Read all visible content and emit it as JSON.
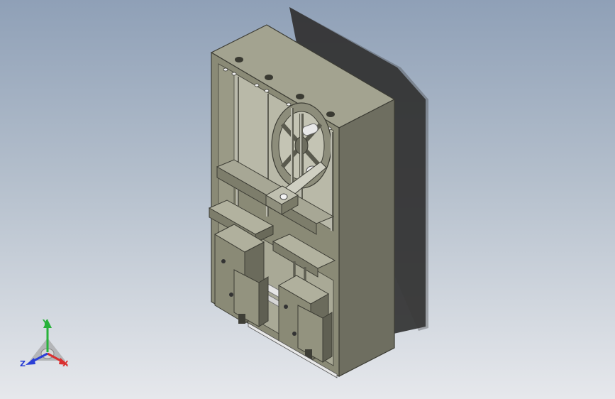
{
  "view": {
    "background_top": "#8fa0b7",
    "background_bottom": "#e6e8ec",
    "model_colors": {
      "body_front": "#8a8a76",
      "body_side": "#6e6e60",
      "body_top": "#a3a390",
      "interior": "#b9b9a8",
      "shadow": "#2f2f2f",
      "steel": "#e8e8e8"
    }
  },
  "triad": {
    "x_label": "X",
    "y_label": "Y",
    "z_label": "Z",
    "x_color": "#d93030",
    "y_color": "#27b23a",
    "z_color": "#2a3fd6",
    "x_icon": "axis-x-arrow",
    "y_icon": "axis-y-arrow",
    "z_icon": "axis-z-arrow"
  }
}
